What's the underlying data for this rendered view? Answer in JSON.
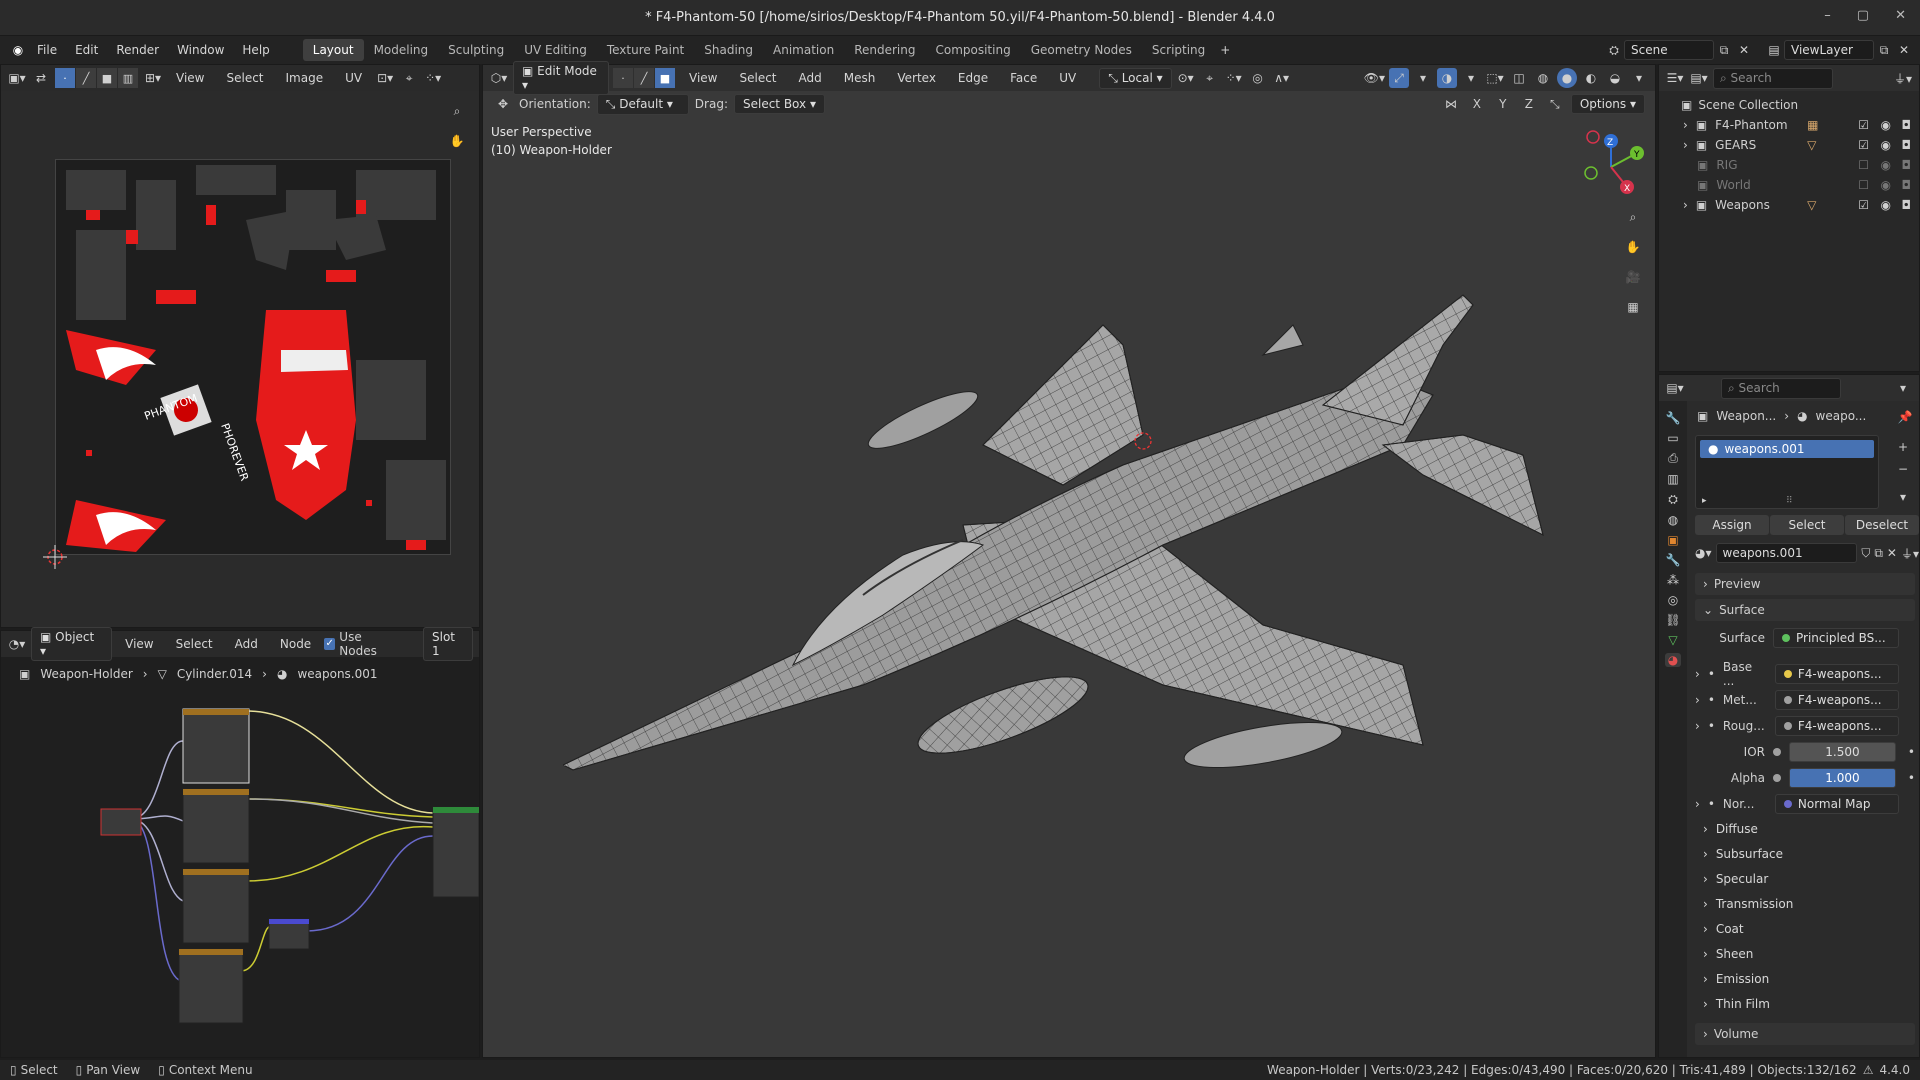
{
  "window": {
    "title": "* F4-Phantom-50 [/home/sirios/Desktop/F4-Phantom 50.yil/F4-Phantom-50.blend] - Blender 4.4.0",
    "controls": [
      "–",
      "▢",
      "✕"
    ]
  },
  "menu": [
    "File",
    "Edit",
    "Render",
    "Window",
    "Help"
  ],
  "workspaces": [
    "Layout",
    "Modeling",
    "Sculpting",
    "UV Editing",
    "Texture Paint",
    "Shading",
    "Animation",
    "Rendering",
    "Compositing",
    "Geometry Nodes",
    "Scripting"
  ],
  "active_workspace": "Layout",
  "scene": {
    "name": "Scene",
    "view_layer": "ViewLayer"
  },
  "image_editor": {
    "menu": [
      "View",
      "Select",
      "Image",
      "UV"
    ]
  },
  "viewport": {
    "mode": "Edit Mode",
    "menu": [
      "View",
      "Select",
      "Add",
      "Mesh",
      "Vertex",
      "Edge",
      "Face",
      "UV"
    ],
    "transform": "Local",
    "orientation_label": "Orientation:",
    "orientation": "Default",
    "drag_label": "Drag:",
    "drag": "Select Box",
    "axes": [
      "X",
      "Y",
      "Z"
    ],
    "options": "Options",
    "info_line1": "User Perspective",
    "info_line2": "(10) Weapon-Holder",
    "search_placeholder": "Search"
  },
  "node_editor": {
    "type": "Object",
    "menu": [
      "View",
      "Select",
      "Add",
      "Node"
    ],
    "use_nodes": "Use Nodes",
    "slot": "Slot 1",
    "breadcrumb": [
      "Weapon-Holder",
      "Cylinder.014",
      "weapons.001"
    ]
  },
  "outliner": {
    "search_placeholder": "Search",
    "root": "Scene Collection",
    "items": [
      {
        "name": "F4-Phantom",
        "checked": true,
        "dim": false,
        "badge": "▦"
      },
      {
        "name": "GEARS",
        "checked": true,
        "dim": false,
        "badge": "▽"
      },
      {
        "name": "RIG",
        "checked": false,
        "dim": true,
        "badge": ""
      },
      {
        "name": "World",
        "checked": false,
        "dim": true,
        "badge": ""
      },
      {
        "name": "Weapons",
        "checked": true,
        "dim": false,
        "badge": "▽"
      }
    ]
  },
  "properties": {
    "search_placeholder": "Search",
    "breadcrumb": [
      "Weapon...",
      "weapo..."
    ],
    "material_slot": "weapons.001",
    "buttons": [
      "Assign",
      "Select",
      "Deselect"
    ],
    "material_name": "weapons.001",
    "preview": "Preview",
    "surface_panel": "Surface",
    "surface_label": "Surface",
    "surface_value": "Principled BS...",
    "inputs": [
      {
        "label": "Base ...",
        "value": "F4-weapons...",
        "color": "#e6c84a"
      },
      {
        "label": "Met...",
        "value": "F4-weapons...",
        "color": "#a0a0a0"
      },
      {
        "label": "Roug...",
        "value": "F4-weapons...",
        "color": "#a0a0a0"
      }
    ],
    "ior_label": "IOR",
    "ior": "1.500",
    "alpha_label": "Alpha",
    "alpha": "1.000",
    "normal_label": "Nor...",
    "normal_value": "Normal Map",
    "sections": [
      "Diffuse",
      "Subsurface",
      "Specular",
      "Transmission",
      "Coat",
      "Sheen",
      "Emission",
      "Thin Film"
    ],
    "volume": "Volume"
  },
  "status": {
    "left": [
      "Select",
      "Pan View",
      "Context Menu"
    ],
    "right": "Weapon-Holder | Verts:0/23,242 | Edges:0/43,490 | Faces:0/20,620 | Tris:41,489 | Objects:132/162",
    "version": "4.4.0"
  },
  "colors": {
    "accent": "#4772b3",
    "selected": "#4772b3",
    "bg": "#303030"
  }
}
